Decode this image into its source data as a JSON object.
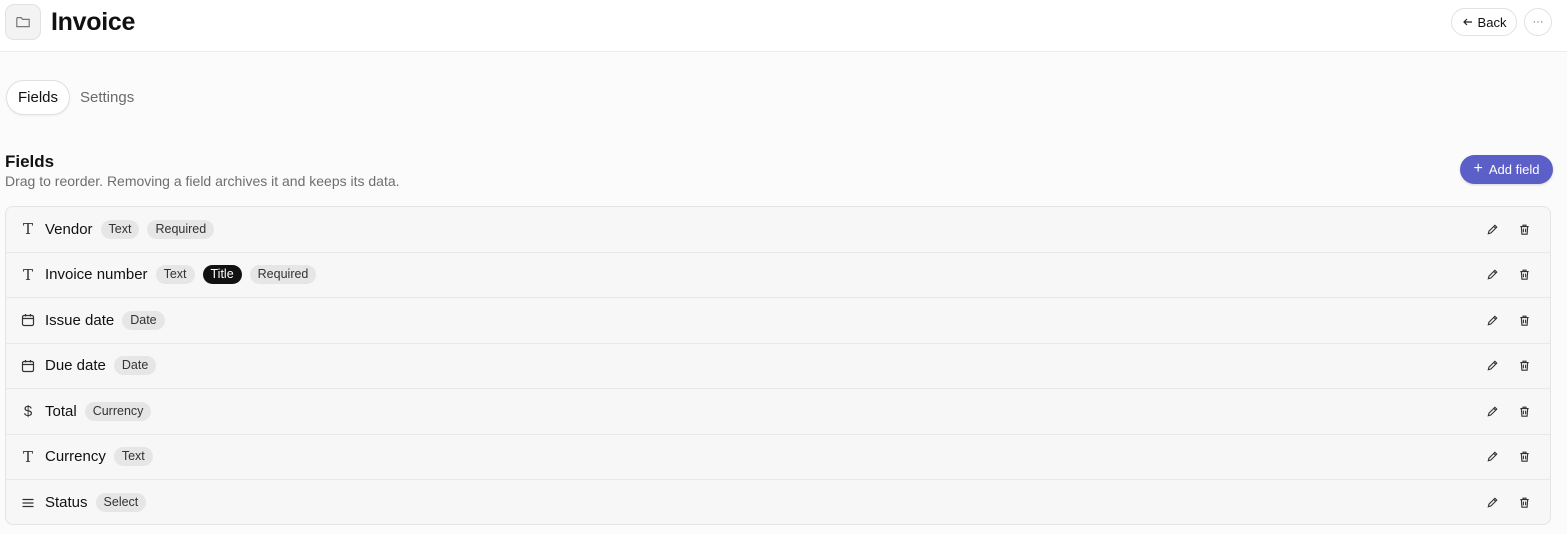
{
  "header": {
    "title": "Invoice",
    "back_label": "Back",
    "more_label": "···",
    "folder_icon": "folder-icon"
  },
  "tabs": [
    {
      "label": "Fields",
      "active": true
    },
    {
      "label": "Settings",
      "active": false
    }
  ],
  "section": {
    "title": "Fields",
    "subtitle": "Drag to reorder. Removing a field archives it and keeps its data.",
    "add_label": "Add field"
  },
  "fields": [
    {
      "name": "Vendor",
      "icon": "text-type-icon",
      "badges": [
        "Text",
        "Required"
      ]
    },
    {
      "name": "Invoice number",
      "icon": "text-type-icon",
      "badges": [
        "Text",
        "Title",
        "Required"
      ]
    },
    {
      "name": "Issue date",
      "icon": "calendar-icon",
      "badges": [
        "Date"
      ]
    },
    {
      "name": "Due date",
      "icon": "calendar-icon",
      "badges": [
        "Date"
      ]
    },
    {
      "name": "Total",
      "icon": "dollar-icon",
      "badges": [
        "Currency"
      ]
    },
    {
      "name": "Currency",
      "icon": "text-type-icon",
      "badges": [
        "Text"
      ]
    },
    {
      "name": "Status",
      "icon": "list-icon",
      "badges": [
        "Select"
      ]
    }
  ],
  "colors": {
    "accent": "#5b5fc7",
    "title_badge": "#111111"
  }
}
